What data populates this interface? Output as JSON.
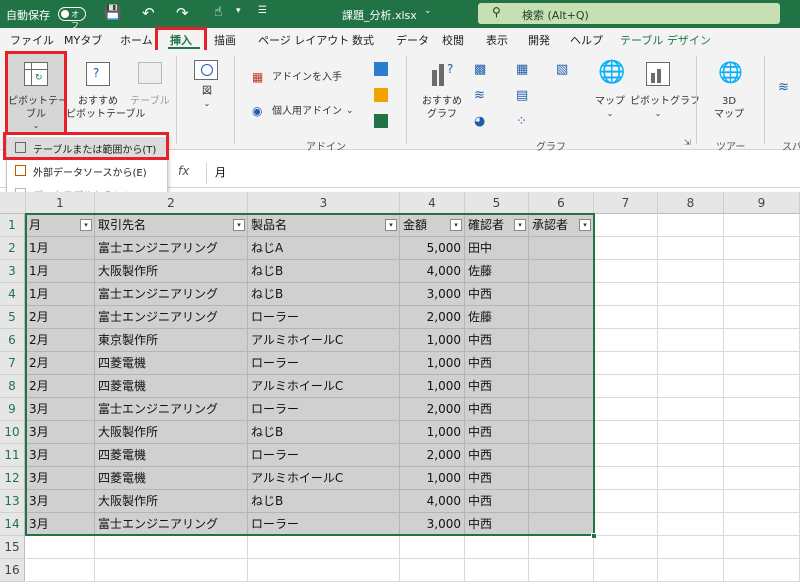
{
  "titlebar": {
    "autosave_label": "自動保存",
    "autosave_state": "オフ",
    "filename": "課題_分析.xlsx",
    "search_placeholder": "検索 (Alt+Q)"
  },
  "ribbon_tabs": [
    "ファイル",
    "MYタブ",
    "ホーム",
    "挿入",
    "描画",
    "ページ レイアウト",
    "数式",
    "データ",
    "校閲",
    "表示",
    "開発",
    "ヘルプ",
    "テーブル デザイン"
  ],
  "active_tab": "挿入",
  "ribbon": {
    "pivot_table": [
      "ピボットテー",
      "ブル"
    ],
    "recommended_pivot": [
      "おすすめ",
      "ピボットテーブル"
    ],
    "table": "テーブル",
    "figure": "図",
    "get_addins": "アドインを入手",
    "personal_addins": "個人用アドイン",
    "addins_group": "アドイン",
    "recommended_charts": [
      "おすすめ",
      "グラフ"
    ],
    "map": "マップ",
    "pivot_chart": "ピボットグラフ",
    "charts_group": "グラフ",
    "map3d": [
      "3D",
      "マップ"
    ],
    "tours_group": "ツアー",
    "spark_group": "スパ"
  },
  "dropdown_menu": [
    {
      "label": "テーブルまたは範囲から(T)",
      "enabled": true
    },
    {
      "label": "外部データソースから(E)",
      "enabled": true
    },
    {
      "label": "データモデルから(D)",
      "enabled": false
    }
  ],
  "formula_bar": {
    "fx": "fx",
    "value": "月"
  },
  "column_headers": [
    "1",
    "2",
    "3",
    "4",
    "5",
    "6",
    "7",
    "8",
    "9"
  ],
  "row_headers": [
    "1",
    "2",
    "3",
    "4",
    "5",
    "6",
    "7",
    "8",
    "9",
    "10",
    "11",
    "12",
    "13",
    "14",
    "15",
    "16"
  ],
  "table": {
    "headers": [
      "月",
      "取引先名",
      "製品名",
      "金額",
      "確認者",
      "承認者"
    ],
    "rows": [
      [
        "1月",
        "富士エンジニアリング",
        "ねじA",
        "5,000",
        "田中",
        ""
      ],
      [
        "1月",
        "大阪製作所",
        "ねじB",
        "4,000",
        "佐藤",
        ""
      ],
      [
        "1月",
        "富士エンジニアリング",
        "ねじB",
        "3,000",
        "中西",
        ""
      ],
      [
        "2月",
        "富士エンジニアリング",
        "ローラー",
        "2,000",
        "佐藤",
        ""
      ],
      [
        "2月",
        "東京製作所",
        "アルミホイールC",
        "1,000",
        "中西",
        ""
      ],
      [
        "2月",
        "四菱電機",
        "ローラー",
        "1,000",
        "中西",
        ""
      ],
      [
        "2月",
        "四菱電機",
        "アルミホイールC",
        "1,000",
        "中西",
        ""
      ],
      [
        "3月",
        "富士エンジニアリング",
        "ローラー",
        "2,000",
        "中西",
        ""
      ],
      [
        "3月",
        "大阪製作所",
        "ねじB",
        "1,000",
        "中西",
        ""
      ],
      [
        "3月",
        "四菱電機",
        "ローラー",
        "2,000",
        "中西",
        ""
      ],
      [
        "3月",
        "四菱電機",
        "アルミホイールC",
        "1,000",
        "中西",
        ""
      ],
      [
        "3月",
        "大阪製作所",
        "ねじB",
        "4,000",
        "中西",
        ""
      ],
      [
        "3月",
        "富士エンジニアリング",
        "ローラー",
        "3,000",
        "中西",
        ""
      ]
    ]
  },
  "colors": {
    "excel_green": "#217346",
    "highlight_red": "#e8202a",
    "selection_gray": "#d0d0d0"
  }
}
